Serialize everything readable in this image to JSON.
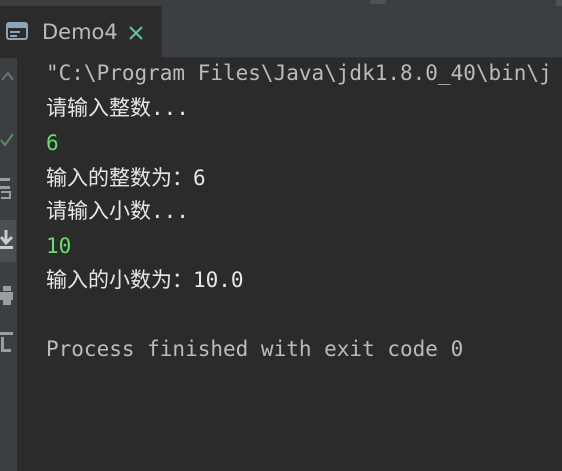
{
  "tab": {
    "label": "Demo4",
    "icon": "console-window-icon",
    "close_icon": "close-icon",
    "accent": "#5fc29b"
  },
  "gutter": {
    "icons": [
      "chevron-up-icon",
      "check-icon",
      "rerun-icon",
      "scroll-to-end-icon",
      "print-icon",
      "trash-icon"
    ]
  },
  "console": {
    "lines": [
      {
        "text": "\"C:\\Program Files\\Java\\jdk1.8.0_40\\bin\\j",
        "kind": "cmd"
      },
      {
        "text": "请输入整数...",
        "kind": "output"
      },
      {
        "text": "6",
        "kind": "input"
      },
      {
        "text": "输入的整数为：6",
        "kind": "output"
      },
      {
        "text": "请输入小数...",
        "kind": "output"
      },
      {
        "text": "10",
        "kind": "input"
      },
      {
        "text": "输入的小数为：10.0",
        "kind": "output"
      },
      {
        "text": "",
        "kind": "blank"
      },
      {
        "text": "Process finished with exit code 0",
        "kind": "exit"
      }
    ],
    "input_color": "#61e26b",
    "text_color": "#e6e6e6"
  }
}
